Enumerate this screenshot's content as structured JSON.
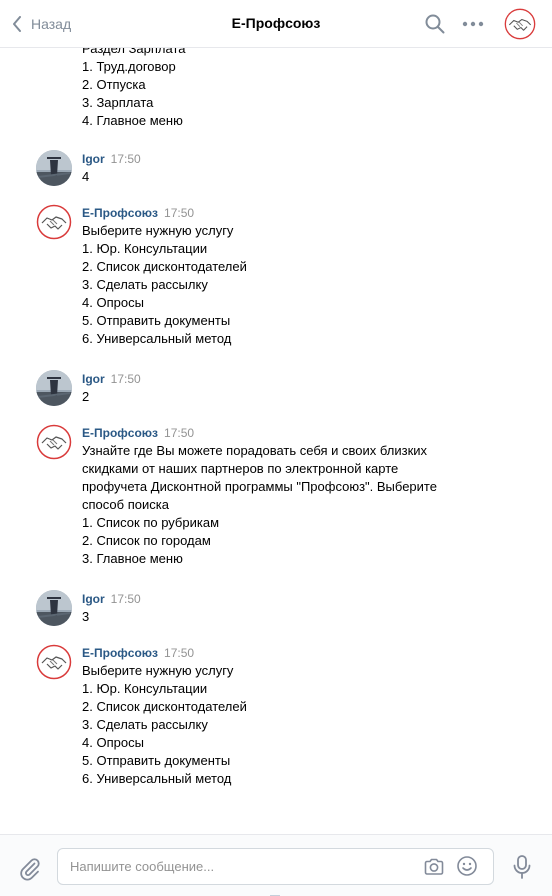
{
  "header": {
    "back_label": "Назад",
    "title": "Е-Профсоюз"
  },
  "icons": {
    "back": "chevron-left-icon",
    "search": "search-icon",
    "more": "more-horizontal-icon",
    "attach": "paperclip-icon",
    "camera": "camera-icon",
    "emoji": "smile-icon",
    "mic": "microphone-icon"
  },
  "colors": {
    "author": "#2a5885",
    "muted": "#939393",
    "header_icon": "#818c99",
    "logo_red": "#d93b3b",
    "border": "#e7e8ec"
  },
  "messages": [
    {
      "author": "",
      "time": "",
      "lines": [
        "Раздел Зарплата",
        "1. Труд.договор",
        "2. Отпуска",
        "3. Зарплата",
        "4. Главное меню"
      ]
    },
    {
      "author": "Igor",
      "time": "17:50",
      "lines": [
        "4"
      ]
    },
    {
      "author": "Е-Профсоюз",
      "time": "17:50",
      "lines": [
        "Выберите нужную услугу",
        "1. Юр. Консультации",
        "2. Список дисконтодателей",
        "3. Сделать рассылку",
        "4. Опросы",
        "5. Отправить документы",
        "6. Универсальный метод"
      ]
    },
    {
      "author": "Igor",
      "time": "17:50",
      "lines": [
        "2"
      ]
    },
    {
      "author": "Е-Профсоюз",
      "time": "17:50",
      "text": "Узнайте где Вы можете порадовать себя и своих близких скидками от наших партнеров по электронной карте профучета Дисконтной программы \"Профсоюз\". Выберите способ поиска",
      "lines": [
        "1. Список по рубрикам",
        "2. Список по городам",
        "3. Главное меню"
      ]
    },
    {
      "author": "Igor",
      "time": "17:50",
      "lines": [
        "3"
      ]
    },
    {
      "author": "Е-Профсоюз",
      "time": "17:50",
      "lines": [
        "Выберите нужную услугу",
        "1. Юр. Консультации",
        "2. Список дисконтодателей",
        "3. Сделать рассылку",
        "4. Опросы",
        "5. Отправить документы",
        "6. Универсальный метод"
      ]
    }
  ],
  "composer": {
    "placeholder": "Напишите сообщение..."
  }
}
